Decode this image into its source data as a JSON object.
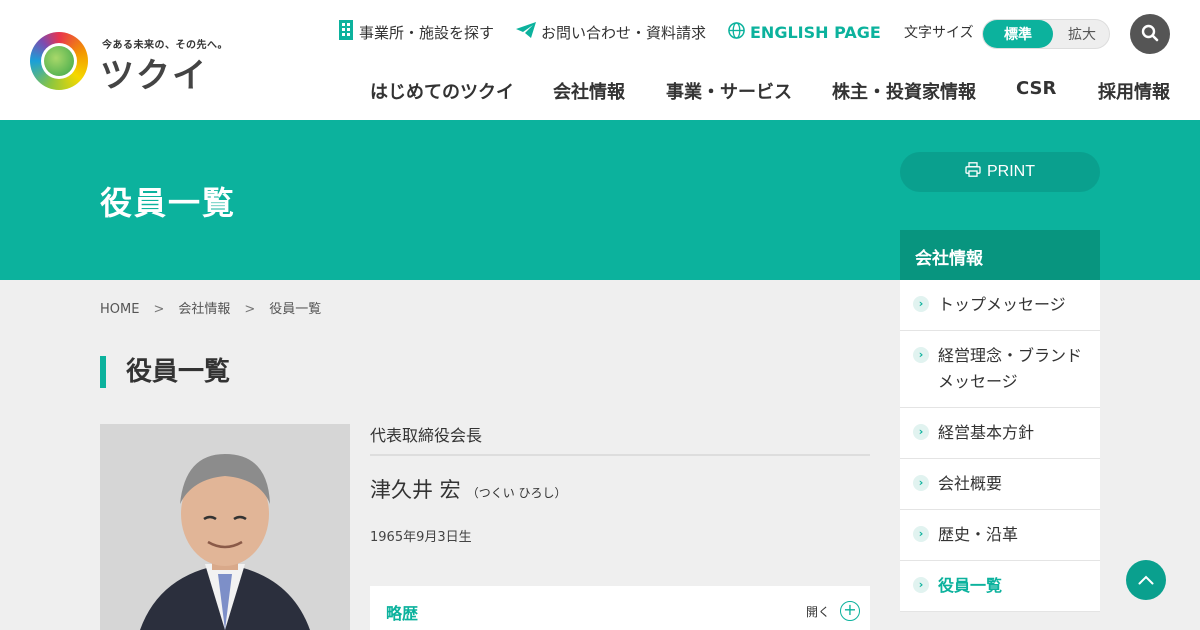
{
  "logo": {
    "tagline": "今ある未来の、その先へ。",
    "name": "ツクイ"
  },
  "utility": {
    "facility": "事業所・施設を探す",
    "contact": "お問い合わせ・資料請求",
    "english": "ENGLISH PAGE",
    "font_size_label": "文字サイズ",
    "font_size_standard": "標準",
    "font_size_large": "拡大"
  },
  "global_nav": [
    {
      "label": "はじめてのツクイ"
    },
    {
      "label": "会社情報"
    },
    {
      "label": "事業・サービス"
    },
    {
      "label": "株主・投資家情報"
    },
    {
      "label": "CSR"
    },
    {
      "label": "採用情報"
    }
  ],
  "hero": {
    "title": "役員一覧"
  },
  "print": {
    "label": "PRINT"
  },
  "breadcrumb": [
    {
      "label": "HOME"
    },
    {
      "label": "会社情報"
    },
    {
      "label": "役員一覧"
    }
  ],
  "breadcrumb_separator": ">",
  "section_title": "役員一覧",
  "executive": {
    "role": "代表取締役会長",
    "name": "津久井 宏",
    "kana": "（つくい ひろし）",
    "birth": "1965年9月3日生",
    "career_label": "略歴",
    "career_toggle": "開く",
    "career_icon": "+"
  },
  "side_nav": {
    "heading": "会社情報",
    "items": [
      {
        "label": "トップメッセージ"
      },
      {
        "label": "経営理念・ブランドメッセージ"
      },
      {
        "label": "経営基本方針"
      },
      {
        "label": "会社概要"
      },
      {
        "label": "歴史・沿革"
      },
      {
        "label": "役員一覧",
        "active": true
      }
    ]
  },
  "colors": {
    "brand": "#0cb29d",
    "brand_dark": "#08957f"
  }
}
